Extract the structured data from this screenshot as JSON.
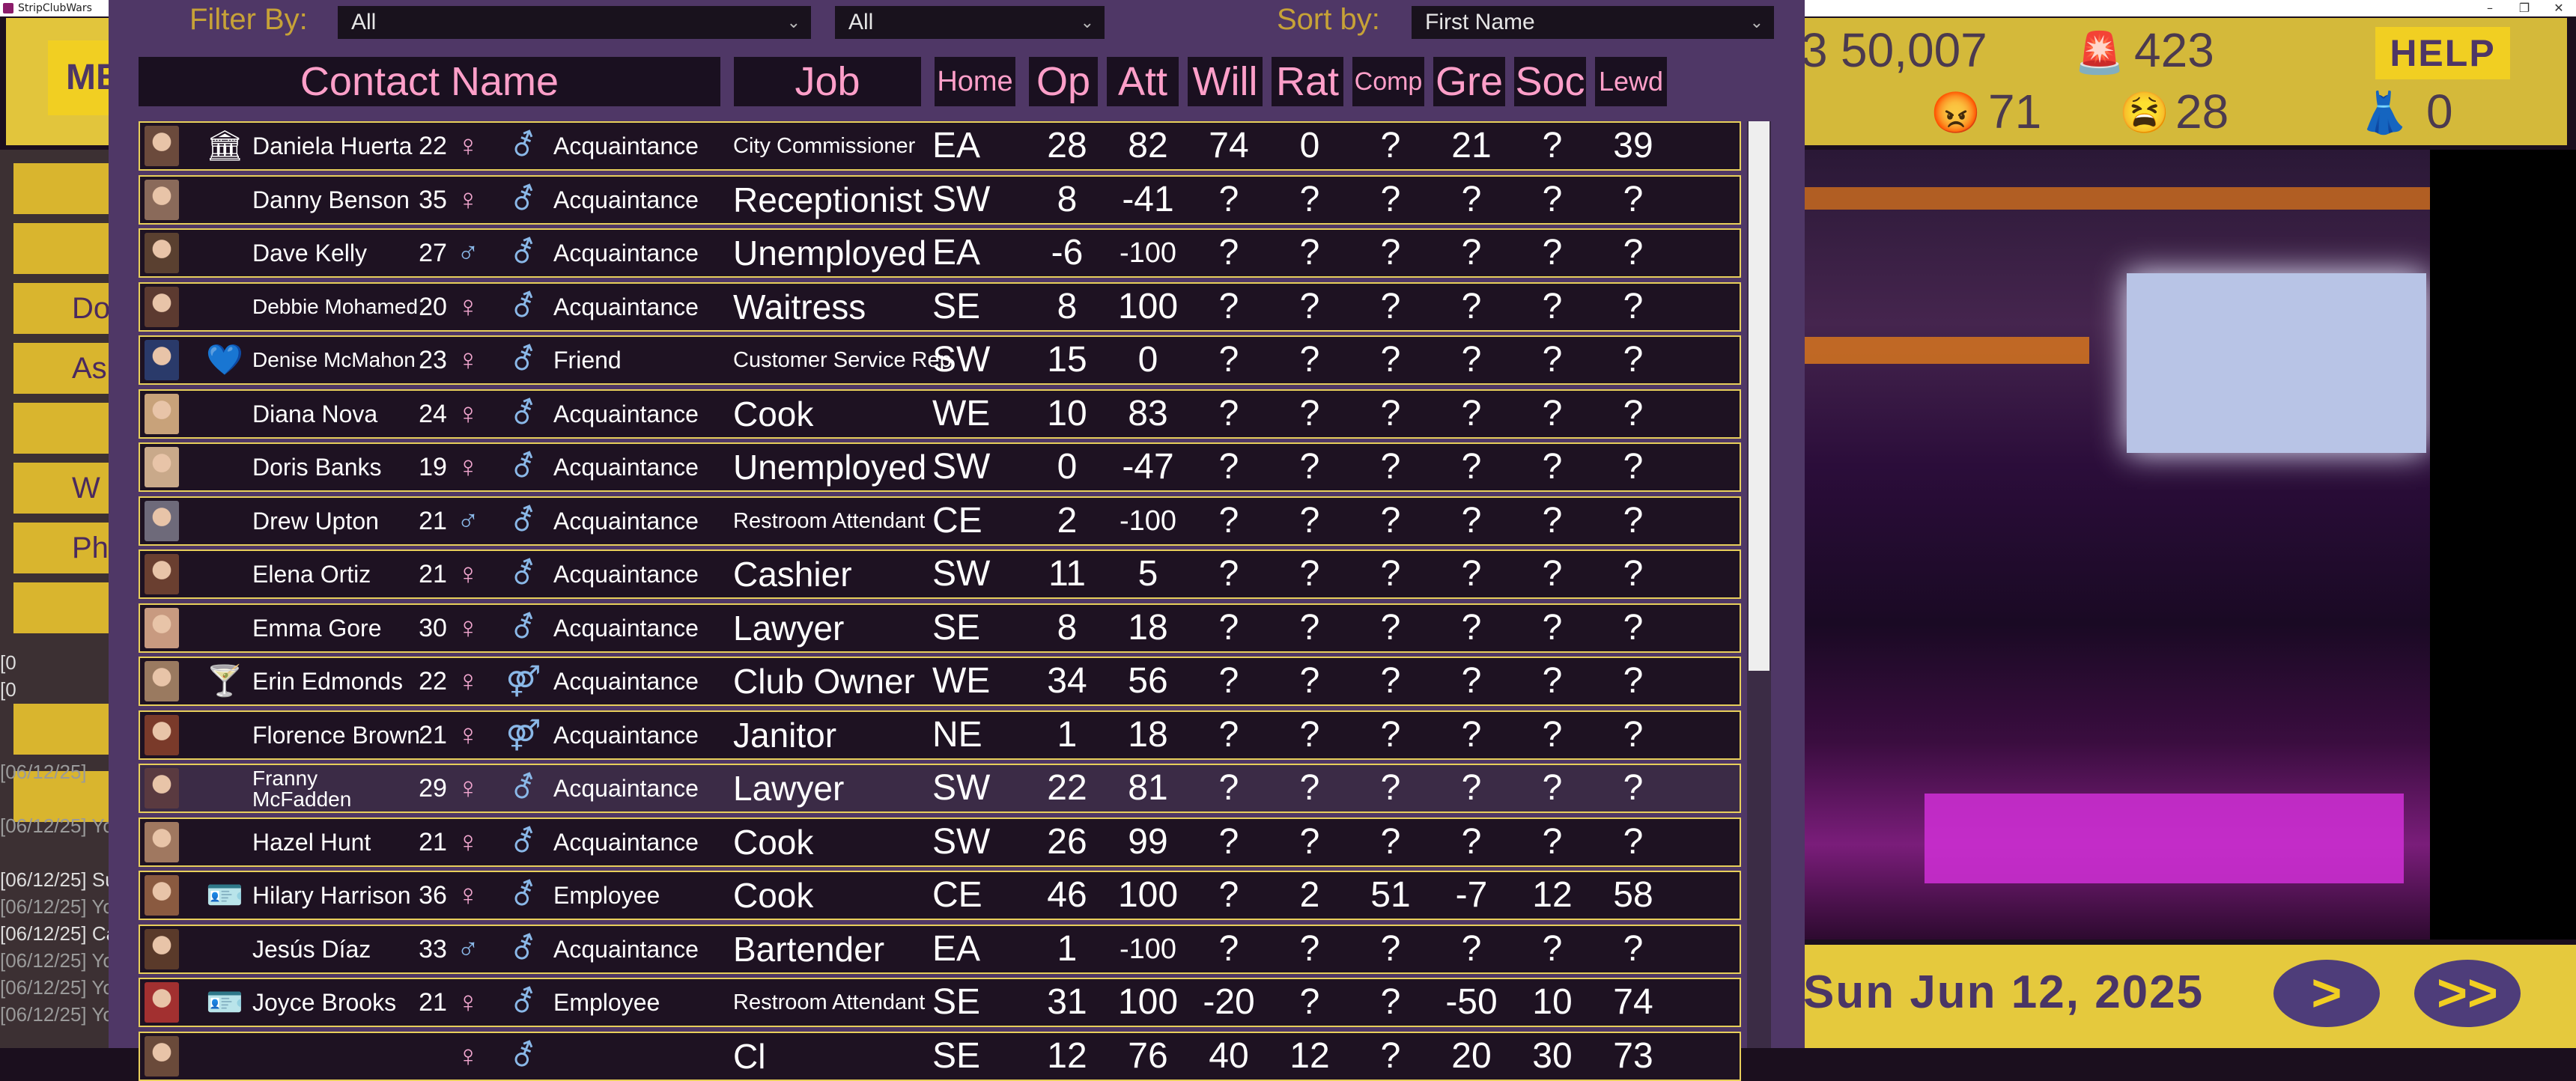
{
  "window": {
    "title": "StripClubWars",
    "min": "–",
    "restore": "❐",
    "close": "✕"
  },
  "topbar": {
    "menu_label": "ME",
    "money": "50,007",
    "alarm": "423",
    "angry": "71",
    "sad": "28",
    "dress": "0",
    "left_partial": "3",
    "help": "HELP"
  },
  "side_buttons": [
    "",
    "",
    "Do",
    "As",
    "",
    "W",
    "Ph",
    "",
    "",
    "",
    ""
  ],
  "log": [
    "[0",
    "[0",
    "[06/12/25]",
    "[06/12/25] Yo",
    "[06/12/25] Su",
    "[06/12/25] Yo",
    "[06/12/25] Ca",
    "[06/12/25] Yo",
    "[06/12/25] Yo",
    "[06/12/25] Yo"
  ],
  "date": "Sun Jun 12, 2025",
  "nav": {
    "next": ">",
    "fast": ">>"
  },
  "filter": {
    "filter_label": "Filter By:",
    "filter1_value": "All",
    "filter2_value": "All",
    "sort_label": "Sort by:",
    "sort_value": "First Name"
  },
  "headers": {
    "name": "Contact Name",
    "job": "Job",
    "home": "Home",
    "op": "Op",
    "att": "Att",
    "will": "Will",
    "rat": "Rat",
    "comp": "Comp",
    "gre": "Gre",
    "soc": "Soc",
    "lewd": "Lewd"
  },
  "contacts": [
    {
      "name": "Daniela Huerta",
      "age": "22",
      "sex": "♀",
      "orient": "⚦",
      "rel": "Acquaintance",
      "job": "City Commissioner",
      "home": "EA",
      "op": "28",
      "att": "82",
      "will": "74",
      "rat": "0",
      "comp": "?",
      "gre": "21",
      "soc": "?",
      "lewd": "39",
      "badge": "🏛",
      "skin": "#6b4a3c"
    },
    {
      "name": "Danny Benson",
      "age": "35",
      "sex": "♀",
      "orient": "⚦",
      "rel": "Acquaintance",
      "job": "Receptionist",
      "home": "SW",
      "op": "8",
      "att": "-41",
      "will": "?",
      "rat": "?",
      "comp": "?",
      "gre": "?",
      "soc": "?",
      "lewd": "?",
      "badge": "",
      "skin": "#8a6a5a"
    },
    {
      "name": "Dave Kelly",
      "age": "27",
      "sex": "♂",
      "orient": "⚦",
      "rel": "Acquaintance",
      "job": "Unemployed",
      "home": "EA",
      "op": "-6",
      "att": "-100",
      "will": "?",
      "rat": "?",
      "comp": "?",
      "gre": "?",
      "soc": "?",
      "lewd": "?",
      "badge": "",
      "skin": "#5a4030"
    },
    {
      "name": "Debbie Mohamed",
      "age": "20",
      "sex": "♀",
      "orient": "⚦",
      "rel": "Acquaintance",
      "job": "Waitress",
      "home": "SE",
      "op": "8",
      "att": "100",
      "will": "?",
      "rat": "?",
      "comp": "?",
      "gre": "?",
      "soc": "?",
      "lewd": "?",
      "badge": "",
      "skin": "#5c3a30"
    },
    {
      "name": "Denise McMahon",
      "age": "23",
      "sex": "♀",
      "orient": "⚦",
      "rel": "Friend",
      "job": "Customer Service Rep",
      "home": "SW",
      "op": "15",
      "att": "0",
      "will": "?",
      "rat": "?",
      "comp": "?",
      "gre": "?",
      "soc": "?",
      "lewd": "?",
      "badge": "💙",
      "skin": "#2a3a6a"
    },
    {
      "name": "Diana Nova",
      "age": "24",
      "sex": "♀",
      "orient": "⚦",
      "rel": "Acquaintance",
      "job": "Cook",
      "home": "WE",
      "op": "10",
      "att": "83",
      "will": "?",
      "rat": "?",
      "comp": "?",
      "gre": "?",
      "soc": "?",
      "lewd": "?",
      "badge": "",
      "skin": "#c8a27a"
    },
    {
      "name": "Doris Banks",
      "age": "19",
      "sex": "♀",
      "orient": "⚦",
      "rel": "Acquaintance",
      "job": "Unemployed",
      "home": "SW",
      "op": "0",
      "att": "-47",
      "will": "?",
      "rat": "?",
      "comp": "?",
      "gre": "?",
      "soc": "?",
      "lewd": "?",
      "badge": "",
      "skin": "#c9a98a"
    },
    {
      "name": "Drew Upton",
      "age": "21",
      "sex": "♂",
      "orient": "⚦",
      "rel": "Acquaintance",
      "job": "Restroom Attendant",
      "home": "CE",
      "op": "2",
      "att": "-100",
      "will": "?",
      "rat": "?",
      "comp": "?",
      "gre": "?",
      "soc": "?",
      "lewd": "?",
      "badge": "",
      "skin": "#6e6a7a"
    },
    {
      "name": "Elena Ortiz",
      "age": "21",
      "sex": "♀",
      "orient": "⚦",
      "rel": "Acquaintance",
      "job": "Cashier",
      "home": "SW",
      "op": "11",
      "att": "5",
      "will": "?",
      "rat": "?",
      "comp": "?",
      "gre": "?",
      "soc": "?",
      "lewd": "?",
      "badge": "",
      "skin": "#6a3f30"
    },
    {
      "name": "Emma Gore",
      "age": "30",
      "sex": "♀",
      "orient": "⚦",
      "rel": "Acquaintance",
      "job": "Lawyer",
      "home": "SE",
      "op": "8",
      "att": "18",
      "will": "?",
      "rat": "?",
      "comp": "?",
      "gre": "?",
      "soc": "?",
      "lewd": "?",
      "badge": "",
      "skin": "#c89a80"
    },
    {
      "name": "Erin Edmonds",
      "age": "22",
      "sex": "♀",
      "orient": "⚤",
      "rel": "Acquaintance",
      "job": "Club Owner",
      "home": "WE",
      "op": "34",
      "att": "56",
      "will": "?",
      "rat": "?",
      "comp": "?",
      "gre": "?",
      "soc": "?",
      "lewd": "?",
      "badge": "🍸",
      "skin": "#9a7a60"
    },
    {
      "name": "Florence Brown",
      "age": "21",
      "sex": "♀",
      "orient": "⚤",
      "rel": "Acquaintance",
      "job": "Janitor",
      "home": "NE",
      "op": "1",
      "att": "18",
      "will": "?",
      "rat": "?",
      "comp": "?",
      "gre": "?",
      "soc": "?",
      "lewd": "?",
      "badge": "",
      "skin": "#7a3a2a"
    },
    {
      "name": "Franny McFadden",
      "age": "29",
      "sex": "♀",
      "orient": "⚦",
      "rel": "Acquaintance",
      "job": "Lawyer",
      "home": "SW",
      "op": "22",
      "att": "81",
      "will": "?",
      "rat": "?",
      "comp": "?",
      "gre": "?",
      "soc": "?",
      "lewd": "?",
      "badge": "",
      "skin": "#5a3a40"
    },
    {
      "name": "Hazel Hunt",
      "age": "21",
      "sex": "♀",
      "orient": "⚦",
      "rel": "Acquaintance",
      "job": "Cook",
      "home": "SW",
      "op": "26",
      "att": "99",
      "will": "?",
      "rat": "?",
      "comp": "?",
      "gre": "?",
      "soc": "?",
      "lewd": "?",
      "badge": "",
      "skin": "#a07860"
    },
    {
      "name": "Hilary Harrison",
      "age": "36",
      "sex": "♀",
      "orient": "⚦",
      "rel": "Employee",
      "job": "Cook",
      "home": "CE",
      "op": "46",
      "att": "100",
      "will": "?",
      "rat": "2",
      "comp": "51",
      "gre": "-7",
      "soc": "12",
      "lewd": "58",
      "badge": "🪪",
      "skin": "#8a5a40"
    },
    {
      "name": "Jesús Díaz",
      "age": "33",
      "sex": "♂",
      "orient": "⚦",
      "rel": "Acquaintance",
      "job": "Bartender",
      "home": "EA",
      "op": "1",
      "att": "-100",
      "will": "?",
      "rat": "?",
      "comp": "?",
      "gre": "?",
      "soc": "?",
      "lewd": "?",
      "badge": "",
      "skin": "#5a3a2a"
    },
    {
      "name": "Joyce Brooks",
      "age": "21",
      "sex": "♀",
      "orient": "⚦",
      "rel": "Employee",
      "job": "Restroom Attendant",
      "home": "SE",
      "op": "31",
      "att": "100",
      "will": "-20",
      "rat": "?",
      "comp": "?",
      "gre": "-50",
      "soc": "10",
      "lewd": "74",
      "badge": "🪪",
      "skin": "#a23030"
    },
    {
      "name": "",
      "age": "",
      "sex": "♀",
      "orient": "⚦",
      "rel": "",
      "job": "Cl",
      "home": "SE",
      "op": "12",
      "att": "76",
      "will": "40",
      "rat": "12",
      "comp": "?",
      "gre": "20",
      "soc": "30",
      "lewd": "73",
      "badge": "",
      "skin": "#6a4a3a"
    }
  ]
}
